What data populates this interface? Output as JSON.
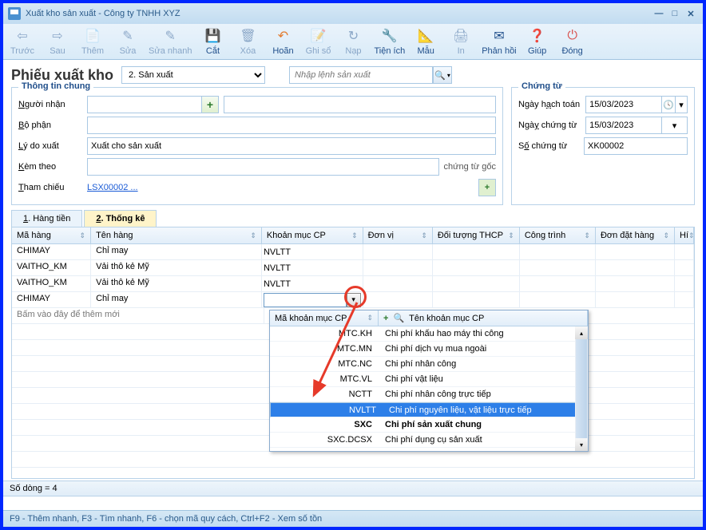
{
  "window": {
    "title": "Xuất kho sản xuất - Công ty TNHH XYZ"
  },
  "toolbar": {
    "truoc": "Trước",
    "sau": "Sau",
    "them": "Thêm",
    "sua": "Sửa",
    "suanhanh": "Sửa nhanh",
    "cat": "Cắt",
    "xoa": "Xóa",
    "hoan": "Hoãn",
    "ghiso": "Ghi sổ",
    "nap": "Nạp",
    "tienich": "Tiện ích",
    "mau": "Mẫu",
    "in": "In",
    "phanhoi": "Phản hồi",
    "giup": "Giúp",
    "dong": "Đóng"
  },
  "page": {
    "title": "Phiếu xuất kho",
    "type": "2. Sản xuất",
    "search_placeholder": "Nhập lệnh sản xuất"
  },
  "info": {
    "group_left": "Thông tin chung",
    "group_right": "Chứng từ",
    "nguoinhan": "Người nhận",
    "bophan": "Bộ phận",
    "lydoxuat": "Lý do xuất",
    "lydoxuat_val": "Xuất cho sản xuất",
    "kemtheo": "Kèm theo",
    "kemtheo_note": "chứng từ gốc",
    "thamchieu": "Tham chiếu",
    "thamchieu_val": "LSX00002 ...",
    "ngayhachtoan": "Ngày hạch toán",
    "ngaychungtu": "Ngày chứng từ",
    "sochungtu": "Số chứng từ",
    "date1": "15/03/2023",
    "date2": "15/03/2023",
    "sono": "XK00002"
  },
  "tabs": {
    "t1": "1. Hàng tiền",
    "t2": "2. Thống kê"
  },
  "grid": {
    "cols": [
      "Mã hàng",
      "Tên hàng",
      "Khoản mục CP",
      "Đơn vị",
      "Đối tượng THCP",
      "Công trình",
      "Đơn đặt hàng",
      "Hí"
    ],
    "rows": [
      {
        "ma": "CHIMAY",
        "ten": "Chỉ may",
        "kmcp": "NVLTT"
      },
      {
        "ma": "VAITHO_KM",
        "ten": "Vải thô kẻ Mỹ",
        "kmcp": "NVLTT"
      },
      {
        "ma": "VAITHO_KM",
        "ten": "Vải thô kẻ Mỹ",
        "kmcp": "NVLTT"
      },
      {
        "ma": "CHIMAY",
        "ten": "Chỉ may",
        "kmcp": ""
      }
    ],
    "new_row": "Bấm vào đây để thêm mới"
  },
  "dropdown": {
    "h1": "Mã khoản mục CP",
    "h2": "Tên khoản mục CP",
    "rows": [
      {
        "code": "MTC.KH",
        "name": "Chi phí khấu hao máy thi công"
      },
      {
        "code": "MTC.MN",
        "name": "Chi phí dịch vụ mua ngoài"
      },
      {
        "code": "MTC.NC",
        "name": "Chi phí nhân công"
      },
      {
        "code": "MTC.VL",
        "name": "Chi phí vật liệu"
      },
      {
        "code": "NCTT",
        "name": "Chi phí nhân công trực tiếp"
      },
      {
        "code": "NVLTT",
        "name": "Chi phí nguyên liệu, vật liệu trực tiếp",
        "sel": true
      },
      {
        "code": "SXC",
        "name": "Chi phí sản xuất chung",
        "bold": true
      },
      {
        "code": "SXC.DCSX",
        "name": "Chi phí dụng cụ sản xuất"
      }
    ]
  },
  "footer": {
    "count": "Số dòng = 4"
  },
  "status": {
    "text": "F9 - Thêm nhanh, F3 - Tìm nhanh, F6 - chọn mã quy cách, Ctrl+F2 - Xem số tồn"
  }
}
